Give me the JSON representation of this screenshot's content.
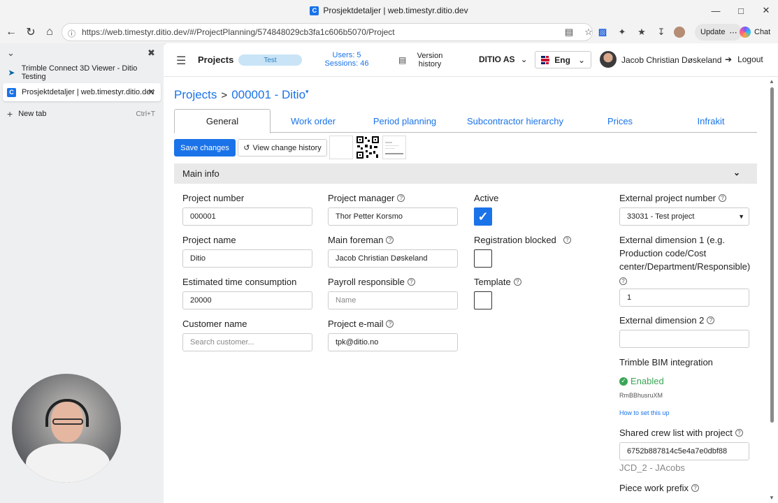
{
  "window": {
    "title": "Prosjektdetaljer | web.timestyr.ditio.dev",
    "url": "https://web.timestyr.ditio.dev/#/ProjectPlanning/574848029cb3fa1c606b5070/Project",
    "update_label": "Update",
    "copilot_label": "Chat"
  },
  "browser_tabs": {
    "items": [
      {
        "label": "Trimble Connect 3D Viewer - Ditio Testing"
      },
      {
        "label": "Prosjektdetaljer | web.timestyr.ditio.dev"
      }
    ],
    "new_tab_label": "New tab",
    "new_tab_shortcut": "Ctrl+T"
  },
  "header": {
    "projects_label": "Projects",
    "env_badge": "Test",
    "users": "Users: 5",
    "sessions": "Sessions: 46",
    "version_history_line1": "Version",
    "version_history_line2": "history",
    "company": "DITIO AS",
    "language": "Eng",
    "user_name": "Jacob Christian Døskeland",
    "logout_label": "Logout"
  },
  "breadcrumb": {
    "root": "Projects",
    "separator": ">",
    "current": "000001 - Ditio"
  },
  "tabs": [
    "General",
    "Work order",
    "Period planning",
    "Subcontractor hierarchy",
    "Prices",
    "Infrakit"
  ],
  "actions": {
    "save": "Save changes",
    "history": "View change history"
  },
  "section": {
    "title": "Main info"
  },
  "form": {
    "project_number": {
      "label": "Project number",
      "value": "000001"
    },
    "project_name": {
      "label": "Project name",
      "value": "Ditio"
    },
    "estimated_time": {
      "label": "Estimated time consumption",
      "value": "20000"
    },
    "customer_name": {
      "label": "Customer name",
      "placeholder": "Search customer..."
    },
    "project_manager": {
      "label": "Project manager",
      "value": "Thor Petter Korsmo"
    },
    "main_foreman": {
      "label": "Main foreman",
      "value": "Jacob Christian Døskeland"
    },
    "payroll_responsible": {
      "label": "Payroll responsible",
      "placeholder": "Name"
    },
    "project_email": {
      "label": "Project e-mail",
      "value": "tpk@ditio.no"
    },
    "active": {
      "label": "Active",
      "checked": true
    },
    "registration_blocked": {
      "label": "Registration blocked",
      "checked": false
    },
    "template": {
      "label": "Template",
      "checked": false
    },
    "external_project_number": {
      "label": "External project number",
      "value": "33031 - Test project"
    },
    "external_dimension_1": {
      "label_line1": "External dimension 1 (e.g.",
      "label_line2": "Production code/Cost",
      "label_line3": "center/Department/Responsible)",
      "value": "1"
    },
    "external_dimension_2": {
      "label": "External dimension 2",
      "value": ""
    },
    "trimble_bim": {
      "label": "Trimble BIM integration",
      "status": "Enabled",
      "code": "RmBBhusruXM",
      "howto": "How to set this up"
    },
    "shared_crew": {
      "label": "Shared crew list with project",
      "value": "6752b887814c5e4a7e0dbf88",
      "sub": "JCD_2 - JAcobs"
    },
    "piece_work_prefix": {
      "label": "Piece work prefix"
    }
  }
}
